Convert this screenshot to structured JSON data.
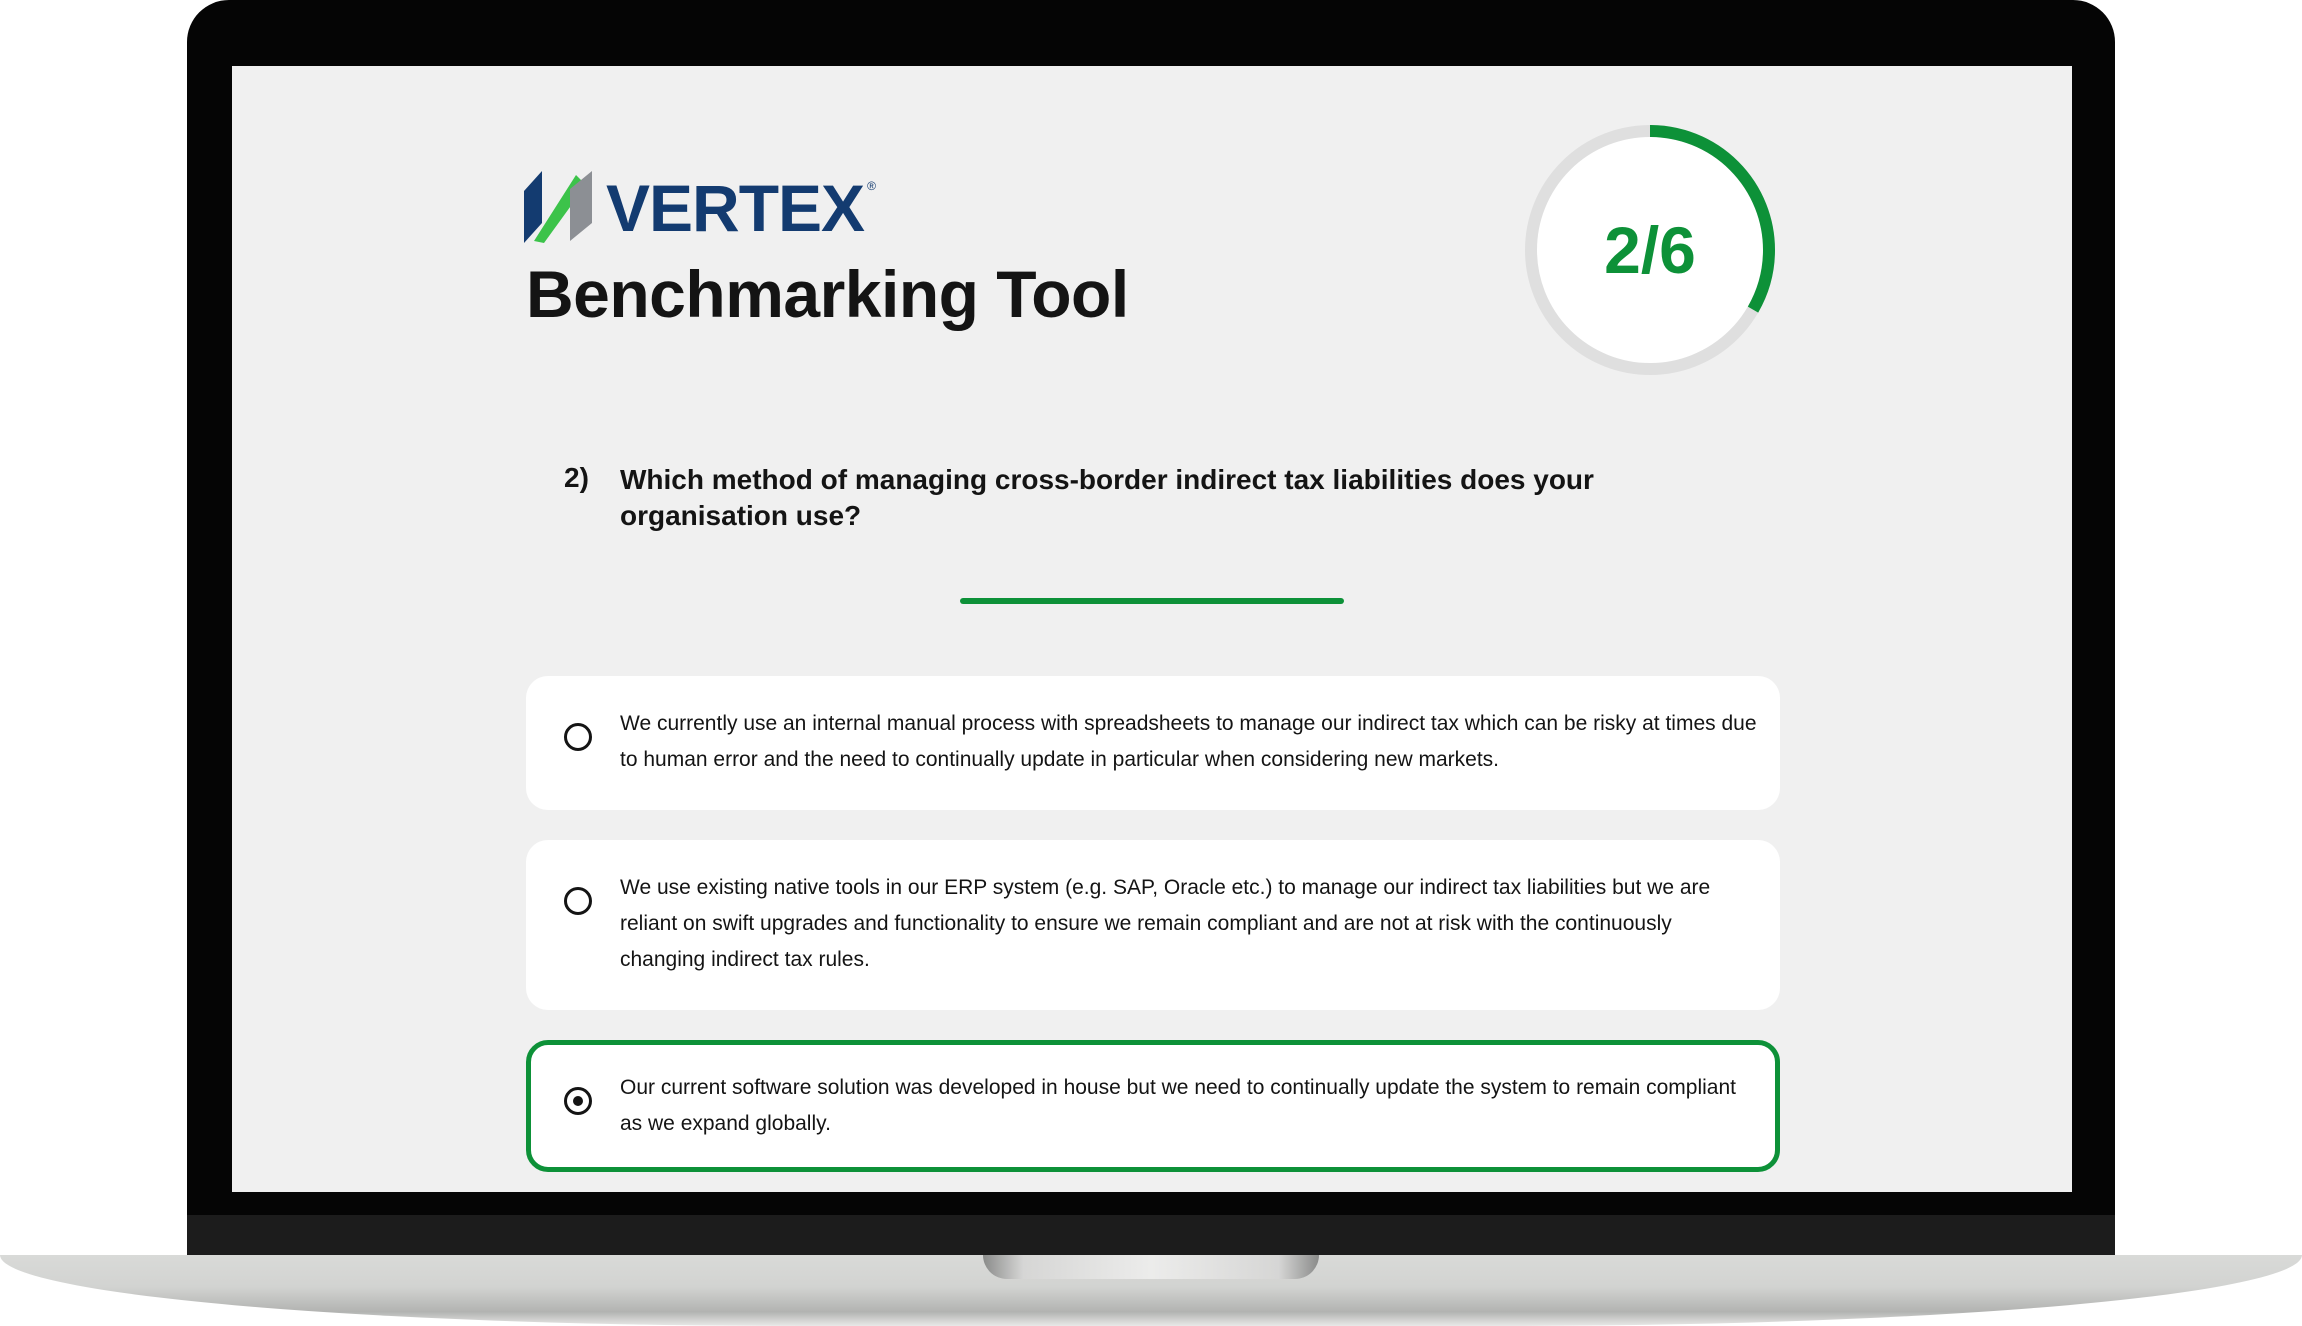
{
  "brand": {
    "name": "VERTEX",
    "registered": "®"
  },
  "page": {
    "title": "Benchmarking Tool"
  },
  "progress": {
    "label": "2/6",
    "current": 2,
    "total": 6,
    "accent_color": "#0d9138",
    "track_color": "#dfdfdf"
  },
  "question": {
    "number": "2)",
    "text": "Which method of managing cross-border indirect tax liabilities does your organisation use?"
  },
  "options": [
    {
      "text": "We currently use an internal manual process with spreadsheets to manage our indirect tax which can be risky at times due to human error and the need to continually update in particular when considering new markets.",
      "selected": false
    },
    {
      "text": "We use existing native tools in our ERP system (e.g. SAP, Oracle etc.) to manage our indirect tax liabilities but we are reliant on swift upgrades and functionality to ensure we remain compliant and are not at risk with the continuously changing indirect tax rules.",
      "selected": false
    },
    {
      "text": "Our current software solution was developed in house but we need to continually update the system to remain compliant as we expand globally.",
      "selected": true
    }
  ],
  "colors": {
    "brand_navy": "#133b70",
    "brand_green": "#3cc34a",
    "brand_gray": "#8c8f94",
    "accent_green": "#0d9138",
    "screen_background": "#f0f0f0"
  }
}
